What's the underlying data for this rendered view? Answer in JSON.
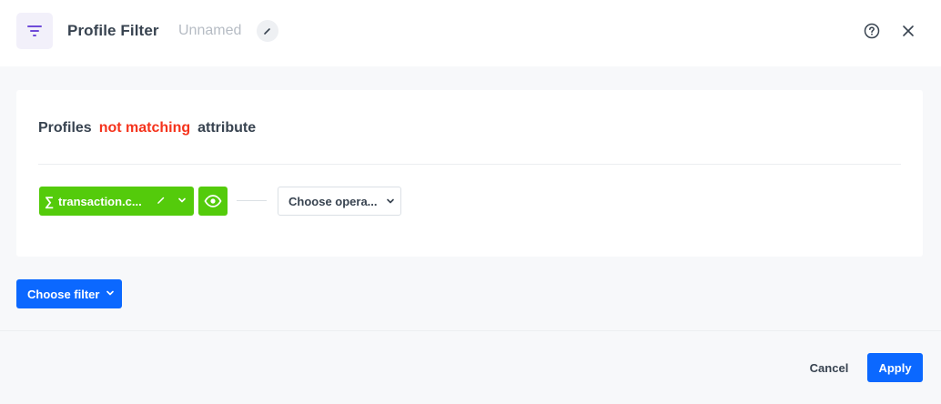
{
  "header": {
    "title": "Profile Filter",
    "name": "Unnamed"
  },
  "condition": {
    "prefix": "Profiles",
    "match_mode": "not matching",
    "suffix": "attribute",
    "attribute": {
      "aggregate_symbol": "∑",
      "label": "transaction.c..."
    },
    "operator_placeholder": "Choose opera..."
  },
  "actions": {
    "choose_filter": "Choose filter",
    "cancel": "Cancel",
    "apply": "Apply"
  },
  "icons": {
    "filter": "filter-icon",
    "edit": "pencil-icon",
    "help": "help-circle-icon",
    "close": "close-icon",
    "visibility": "eye-icon",
    "dropdown": "chevron-down-icon"
  },
  "colors": {
    "primary": "#0b68ff",
    "attribute_green": "#54cb0b",
    "negation_red": "#f5331c",
    "accent_purple": "#6f4bd8"
  }
}
